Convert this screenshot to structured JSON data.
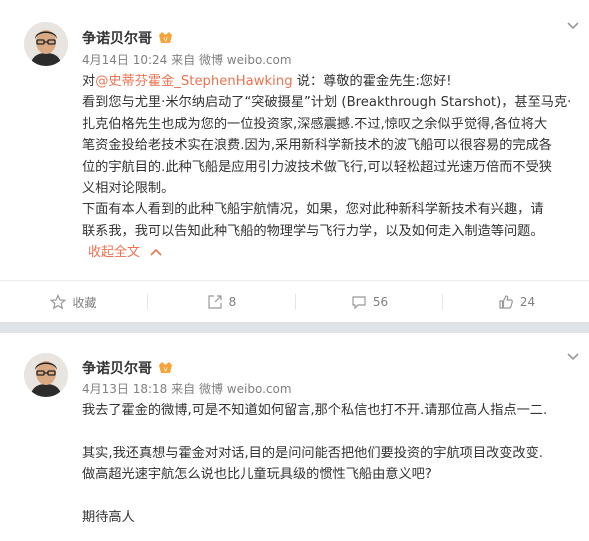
{
  "posts": [
    {
      "username": "争诺贝尔哥",
      "time": "4月14日 10:24",
      "source_prefix": "来自",
      "source": "微博 weibo.com",
      "line0_prefix": "对",
      "line0_link": "@史蒂芬霍金_StephenHawking",
      "line0_suffix": " 说：尊敬的霍金先生:您好!",
      "lines": [
        "看到您与尤里·米尔纳启动了“突破摄星”计划 (Breakthrough Starshot)，甚至马克·",
        "扎克伯格先生也成为您的一位投资家,深感震撼.不过,惊叹之余似乎觉得,各位将大",
        "笔资金投给老技术实在浪费.因为,采用新科学新技术的波飞船可以很容易的完成各",
        "位的宇航目的.此种飞船是应用引力波技术做飞行,可以轻松超过光速万倍而不受狭",
        "义相对论限制。",
        "下面有本人看到的此种飞船宇航情况，如果，您对此种新科学新技术有兴趣，请",
        "联系我，我可以告知此种飞船的物理学与飞行力学，以及如何走入制造等问题。"
      ],
      "collapse_label": "收起全文",
      "actions": {
        "favorite": "收藏",
        "repost": "8",
        "comment": "56",
        "like": "24"
      }
    },
    {
      "username": "争诺贝尔哥",
      "time": "4月13日 18:18",
      "source_prefix": "来自",
      "source": "微博 weibo.com",
      "lines": [
        "我去了霍金的微博,可是不知道如何留言,那个私信也打不开.请那位高人指点一二.",
        "",
        "其实,我还真想与霍金对对话,目的是问问能否把他们要投资的宇航项目改变改变.",
        "做高超光速宇航怎么说也比儿童玩具级的惯性飞船由意义吧?",
        "",
        "期待高人"
      ]
    }
  ],
  "colors": {
    "link": "#eb7350",
    "meta": "#808080",
    "text": "#333333",
    "background": "#dfe3e8"
  },
  "icons": [
    "avatar",
    "vip-badge-icon",
    "chevron-down-icon",
    "star-icon",
    "repost-icon",
    "comment-icon",
    "thumbs-up-icon",
    "chevron-up-icon"
  ]
}
